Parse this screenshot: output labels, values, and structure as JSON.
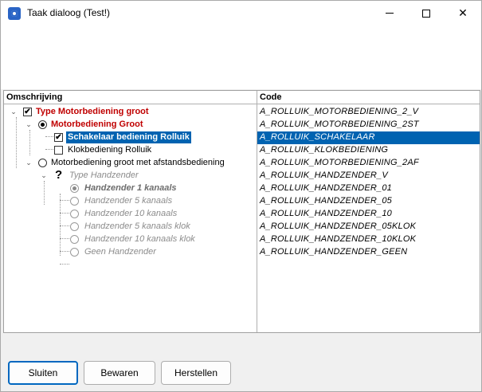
{
  "window": {
    "title": "Taak dialoog (Test!)"
  },
  "grid": {
    "columns": {
      "description": "Omschrijving",
      "code": "Code"
    },
    "rows": [
      {
        "label": "Type Motorbediening groot",
        "code": "A_ROLLUIK_MOTORBEDIENING_2_V"
      },
      {
        "label": "Motorbediening Groot",
        "code": "A_ROLLUIK_MOTORBEDIENING_2ST"
      },
      {
        "label": "Schakelaar bediening Rolluik",
        "code": "A_ROLLUIK_SCHAKELAAR"
      },
      {
        "label": "Klokbediening Rolluik",
        "code": "A_ROLLUIK_KLOKBEDIENING"
      },
      {
        "label": "Motorbediening groot met afstandsbediening",
        "code": "A_ROLLUIK_MOTORBEDIENING_2AF"
      },
      {
        "label": "Type Handzender",
        "code": "A_ROLLUIK_HANDZENDER_V"
      },
      {
        "label": "Handzender 1 kanaals",
        "code": "A_ROLLUIK_HANDZENDER_01"
      },
      {
        "label": "Handzender 5 kanaals",
        "code": "A_ROLLUIK_HANDZENDER_05"
      },
      {
        "label": "Handzender 10 kanaals",
        "code": "A_ROLLUIK_HANDZENDER_10"
      },
      {
        "label": "Handzender 5 kanaals klok",
        "code": "A_ROLLUIK_HANDZENDER_05KLOK"
      },
      {
        "label": "Handzender 10 kanaals klok",
        "code": "A_ROLLUIK_HANDZENDER_10KLOK"
      },
      {
        "label": "Geen Handzender",
        "code": "A_ROLLUIK_HANDZENDER_GEEN"
      }
    ]
  },
  "buttons": {
    "close": "Sluiten",
    "save": "Bewaren",
    "restore": "Herstellen"
  },
  "icons": {
    "check": "✔",
    "chevron": "⌄",
    "question": "?"
  },
  "colors": {
    "selection": "#0063b1",
    "required": "#c00000",
    "disabled": "#8c8c8c"
  }
}
